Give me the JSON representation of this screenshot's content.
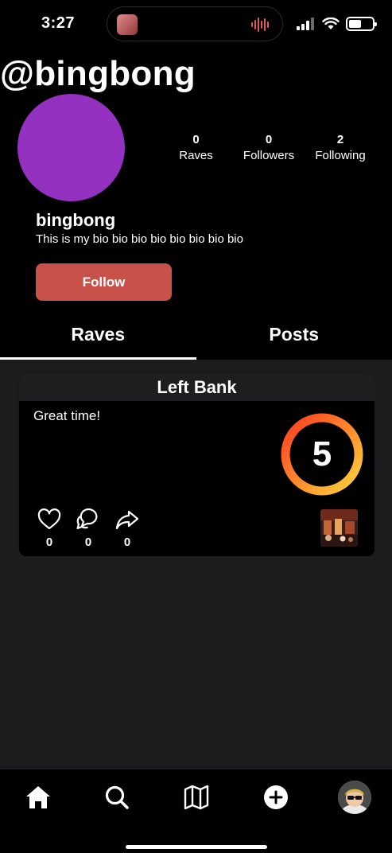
{
  "status_bar": {
    "time": "3:27",
    "battery_level": 0.55
  },
  "profile": {
    "handle": "@bingbong",
    "avatar_color": "#9431c0",
    "name": "bingbong",
    "bio": "This is my bio bio bio bio bio bio bio bio",
    "stats": [
      {
        "value": "0",
        "label": "Raves"
      },
      {
        "value": "0",
        "label": "Followers"
      },
      {
        "value": "2",
        "label": "Following"
      }
    ],
    "follow_label": "Follow",
    "follow_color": "#c8524a"
  },
  "tabs": [
    {
      "label": "Raves",
      "active": true
    },
    {
      "label": "Posts",
      "active": false
    }
  ],
  "rave_card": {
    "venue": "Left Bank",
    "comment": "Great time!",
    "score": "5",
    "score_ring_colors": [
      "#ff3b1f",
      "#ffd43b"
    ],
    "likes": "0",
    "comments": "0",
    "shares": "0"
  },
  "bottom_nav": {
    "items": [
      "home-icon",
      "search-icon",
      "map-icon",
      "add-icon",
      "profile-avatar"
    ]
  }
}
